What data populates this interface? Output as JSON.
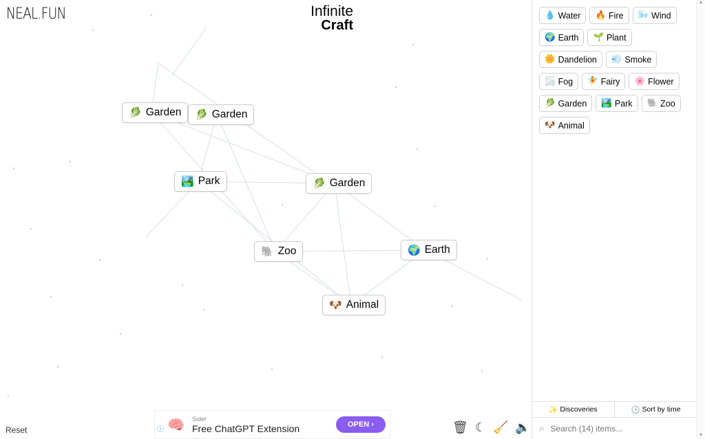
{
  "header": {
    "logo": "NEAL.FUN",
    "title_line1": "Infinite",
    "title_line2": "Craft"
  },
  "canvas_nodes": [
    {
      "label": "Garden",
      "icon": "🥬"
    },
    {
      "label": "Garden",
      "icon": "🥬"
    },
    {
      "label": "Park",
      "icon": "🏞️"
    },
    {
      "label": "Garden",
      "icon": "🥬"
    },
    {
      "label": "Zoo",
      "icon": "🐘"
    },
    {
      "label": "Earth",
      "icon": "🌍"
    },
    {
      "label": "Animal",
      "icon": "🐶"
    }
  ],
  "sidebar": {
    "items": [
      {
        "label": "Water",
        "icon": "💧"
      },
      {
        "label": "Fire",
        "icon": "🔥"
      },
      {
        "label": "Wind",
        "icon": "🌬️"
      },
      {
        "label": "Earth",
        "icon": "🌍"
      },
      {
        "label": "Plant",
        "icon": "🌱"
      },
      {
        "label": "Dandelion",
        "icon": "🌼"
      },
      {
        "label": "Smoke",
        "icon": "💨"
      },
      {
        "label": "Fog",
        "icon": "🌫️"
      },
      {
        "label": "Fairy",
        "icon": "🧚"
      },
      {
        "label": "Flower",
        "icon": "🌸"
      },
      {
        "label": "Garden",
        "icon": "🥬"
      },
      {
        "label": "Park",
        "icon": "🏞️"
      },
      {
        "label": "Zoo",
        "icon": "🐘"
      },
      {
        "label": "Animal",
        "icon": "🐶"
      }
    ],
    "discoveries": "Discoveries",
    "sort": "Sort by time",
    "search_placeholder": "Search (14) items..."
  },
  "footer": {
    "reset": "Reset"
  },
  "ad": {
    "sponsor": "Sider",
    "headline": "Free ChatGPT Extension",
    "cta": "OPEN ›"
  }
}
